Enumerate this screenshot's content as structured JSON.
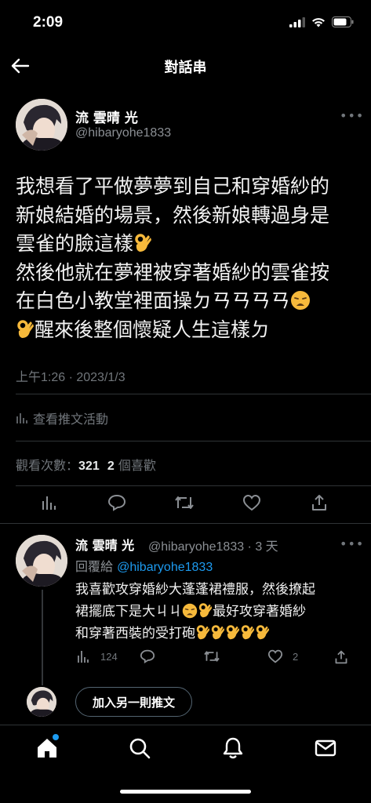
{
  "status_bar": {
    "time": "2:09"
  },
  "header": {
    "title": "對話串"
  },
  "main_tweet": {
    "author_name": "流 雲晴 光",
    "author_handle": "@hibaryohe1833",
    "text_lines": [
      "我想看了平做夢夢到自己和穿婚紗的",
      "新娘結婚的場景，然後新娘轉過身是",
      "雲雀的臉這樣",
      "然後他就在夢裡被穿著婚紗的雲雀按",
      "在白色小教堂裡面操ㄉㄢㄢㄢㄢ",
      "醒來後整個懷疑人生這樣ㄉ"
    ],
    "timestamp": "上午1:26 · 2023/1/3",
    "activity_label": "查看推文活動",
    "views_label": "觀看次數：",
    "views_count": "321",
    "likes_count": "2",
    "likes_label": "個喜歡"
  },
  "reply": {
    "author_name": "流 雲晴 光",
    "author_handle_time": "@hibaryohe1833 · 3 天",
    "reply_to_label": "回覆給",
    "reply_to_handle": "@hibaryohe1833",
    "text_lines": [
      "我喜歡攻穿婚紗大蓬蓬裙禮服，然後撩起",
      "裙擺底下是大ㄐㄐ",
      "最好攻穿著婚紗",
      "和穿著西裝的受打砲"
    ],
    "views_count": "124",
    "likes_count": "2"
  },
  "add_tweet_button": "加入另一則推文",
  "tab_bar": [
    "home-icon",
    "search-icon",
    "notifications-icon",
    "messages-icon"
  ],
  "colors": {
    "accent": "#1d9bf0",
    "muted": "#71767b",
    "background": "#000000"
  }
}
